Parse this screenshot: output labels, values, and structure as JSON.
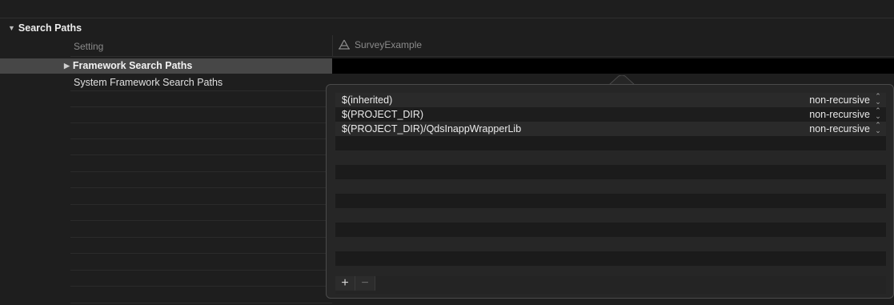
{
  "section": {
    "title": "Search Paths"
  },
  "columns": {
    "setting": "Setting",
    "target": "SurveyExample",
    "target_icon": "xcode-target-icon"
  },
  "rows": {
    "framework": "Framework Search Paths",
    "system_framework": "System Framework Search Paths"
  },
  "popover": {
    "items": [
      {
        "path": "$(inherited)",
        "mode": "non-recursive"
      },
      {
        "path": "$(PROJECT_DIR)",
        "mode": "non-recursive"
      },
      {
        "path": "$(PROJECT_DIR)/QdsInappWrapperLib",
        "mode": "non-recursive"
      }
    ],
    "add_label": "+",
    "remove_label": "−"
  }
}
